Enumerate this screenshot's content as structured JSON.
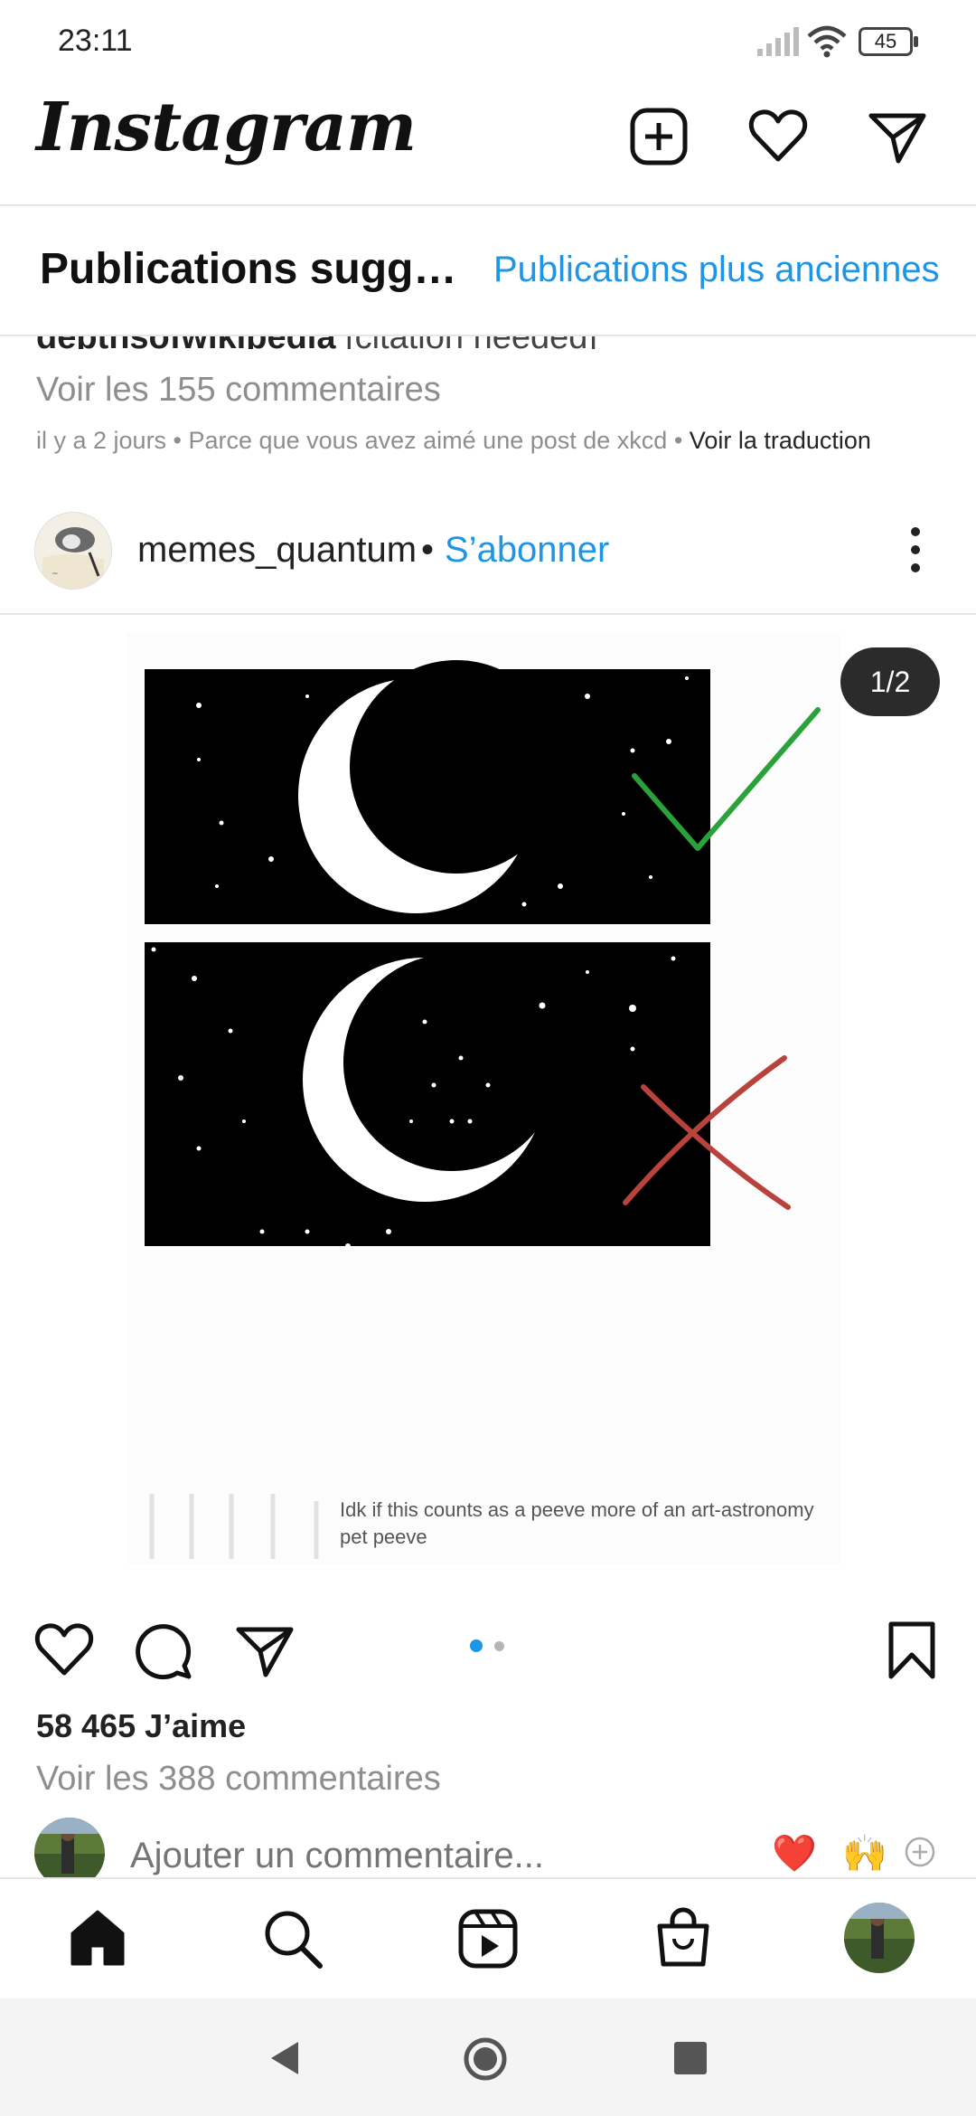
{
  "status_bar": {
    "time": "23:11",
    "battery": "45"
  },
  "header": {
    "logo": "Instagram",
    "icons": [
      "add-post-icon",
      "heart-icon",
      "direct-message-icon"
    ]
  },
  "tabs": {
    "suggested": "Publications sugg…",
    "older": "Publications plus anciennes"
  },
  "previous_post": {
    "caption_user": "depthsofwikipedia",
    "caption_text": "[citation needed]",
    "comments": "Voir les 155 commentaires",
    "meta": "il y a 2 jours • Parce que vous avez aimé une post de xkcd •",
    "translate": "Voir la traduction"
  },
  "post": {
    "username": "memes_quantum",
    "separator": "•",
    "follow": "S’abonner",
    "page_counter": "1/2",
    "image_caption_line1": "Idk if this counts as a peeve more of an art-astronomy",
    "image_caption_line2": "pet peeve",
    "carousel": {
      "current": 1,
      "total": 2
    },
    "likes": "58 465 J’aime",
    "view_comments": "Voir les 388 commentaires",
    "comment_placeholder": "Ajouter un commentaire...",
    "quick_reactions": [
      "❤️",
      "🙌"
    ]
  },
  "colors": {
    "accent": "#1f95e5",
    "check": "#2aa23a",
    "cross": "#b8423c",
    "muted": "#8e8e8e"
  },
  "bottom_nav": [
    "home-icon",
    "search-icon",
    "reels-icon",
    "shop-icon",
    "profile-avatar"
  ],
  "system_nav": [
    "back-icon",
    "home-circle-icon",
    "recents-icon"
  ]
}
